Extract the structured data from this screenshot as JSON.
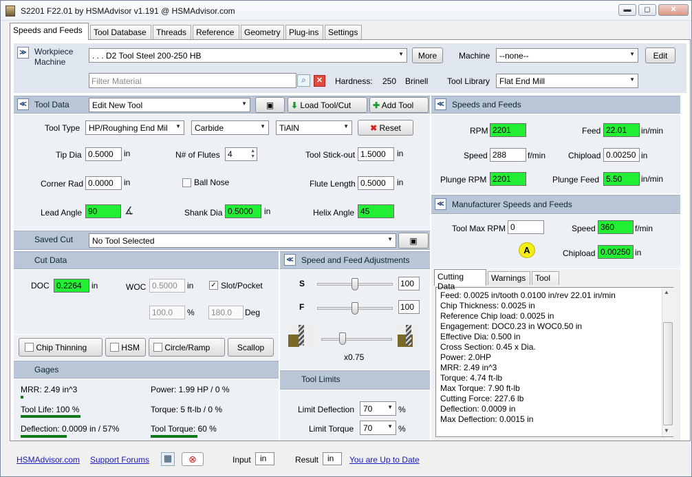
{
  "window": {
    "title": "S2201 F22.01 by HSMAdvisor v1.191 @ HSMAdvisor.com",
    "min": "▬",
    "max": "◻",
    "close": "✕"
  },
  "tabs": [
    "Speeds and Feeds",
    "Tool Database",
    "Threads",
    "Reference",
    "Geometry",
    "Plug-ins",
    "Settings"
  ],
  "workpiece": {
    "label_line1": "Workpiece",
    "label_line2": "Machine",
    "material": ". . . D2 Tool Steel 200-250 HB",
    "more": "More",
    "machine_label": "Machine",
    "machine": "--none--",
    "edit": "Edit",
    "filter_placeholder": "Filter Material",
    "hardness_label": "Hardness:",
    "hardness_value": "250",
    "hardness_unit": "Brinell",
    "library_label": "Tool Library",
    "library": "Flat End Mill"
  },
  "tool_data": {
    "header": "Tool Data",
    "tool_select": "Edit New Tool",
    "load": "Load Tool/Cut",
    "add": "Add Tool",
    "type_label": "Tool Type",
    "type": "HP/Roughing End Mil",
    "material": "Carbide",
    "coating": "TiAlN",
    "reset": "Reset",
    "tip_dia_label": "Tip Dia",
    "tip_dia": "0.5000",
    "tip_dia_unit": "in",
    "flutes_label": "N# of Flutes",
    "flutes": "4",
    "stickout_label": "Tool Stick-out",
    "stickout": "1.5000",
    "stickout_unit": "in",
    "corner_label": "Corner Rad",
    "corner": "0.0000",
    "corner_unit": "in",
    "ballnose_label": "Ball Nose",
    "flute_len_label": "Flute Length",
    "flute_len": "0.5000",
    "flute_len_unit": "in",
    "lead_label": "Lead Angle",
    "lead": "90",
    "shank_label": "Shank Dia",
    "shank": "0.5000",
    "shank_unit": "in",
    "helix_label": "Helix Angle",
    "helix": "45"
  },
  "saved_cut": {
    "label": "Saved Cut",
    "value": "No Tool Selected"
  },
  "cut_data": {
    "header": "Cut Data",
    "doc_label": "DOC",
    "doc": "0.2264",
    "doc_unit": "in",
    "woc_label": "WOC",
    "woc": "0.5000",
    "woc_unit": "in",
    "slot_label": "Slot/Pocket",
    "pct": "100.0",
    "pct_unit": "%",
    "deg": "180.0",
    "deg_unit": "Deg"
  },
  "options": {
    "chip_thinning": "Chip Thinning",
    "hsm": "HSM",
    "circle_ramp": "Circle/Ramp",
    "scallop": "Scallop"
  },
  "adjust": {
    "header": "Speed and Feed Adjustments",
    "s_label": "S",
    "s_value": "100",
    "f_label": "F",
    "f_value": "100",
    "factor": "x0.75",
    "s_level": 0.5,
    "f_level": 0.5,
    "engage_level": 0.3
  },
  "gages": {
    "header": "Gages",
    "mrr": "MRR: 2.49 in^3",
    "power": "Power: 1.99 HP / 0 %",
    "tool_life": "Tool Life: 100 %",
    "torque": "Torque: 5 ft-lb / 0 %",
    "deflection": "Deflection: 0.0009 in / 57%",
    "tool_torque": "Tool Torque: 60 %",
    "mrr_level": 0.0,
    "tool_life_level": 1.0,
    "deflection_level": 0.57,
    "tool_torque_level": 0.6
  },
  "limits": {
    "header": "Tool Limits",
    "deflection_label": "Limit Deflection",
    "deflection": "70",
    "torque_label": "Limit Torque",
    "torque": "70",
    "unit": "%"
  },
  "speeds": {
    "header": "Speeds and Feeds",
    "rpm_label": "RPM",
    "rpm": "2201",
    "feed_label": "Feed",
    "feed": "22.01",
    "feed_unit": "in/min",
    "speed_label": "Speed",
    "speed": "288",
    "speed_unit": "f/min",
    "chipload_label": "Chipload",
    "chipload": "0.00250",
    "chipload_unit": "in",
    "plunge_rpm_label": "Plunge RPM",
    "plunge_rpm": "2201",
    "plunge_feed_label": "Plunge Feed",
    "plunge_feed": "5.50",
    "plunge_feed_unit": "in/min"
  },
  "manufacturer": {
    "header": "Manufacturer Speeds and Feeds",
    "max_rpm_label": "Tool Max RPM",
    "max_rpm": "0",
    "speed_label": "Speed",
    "speed": "360",
    "speed_unit": "f/min",
    "chipload_label": "Chipload",
    "chipload": "0.00250",
    "chipload_unit": "in",
    "badge": "A"
  },
  "output_tabs": [
    "Cutting Data",
    "Warnings",
    "Tool"
  ],
  "cutting_data": [
    "Feed: 0.0025 in/tooth 0.0100 in/rev 22.01 in/min",
    "Chip Thickness: 0.0025 in",
    "Reference Chip load: 0.0025 in",
    "Engagement: DOC0.23 in  WOC0.50 in",
    "Effective Dia: 0.500 in",
    "Cross Section: 0.45 x Dia.",
    "Power: 2.0HP",
    "MRR: 2.49 in^3",
    "Torque: 4.74 ft-lb",
    "Max Torque: 7.90 ft-lb",
    "Cutting Force: 227.6 lb",
    "Deflection: 0.0009 in",
    "Max Deflection: 0.0015 in"
  ],
  "footer": {
    "site": "HSMAdvisor.com",
    "forums": "Support Forums",
    "input_label": "Input",
    "input": "in",
    "result_label": "Result",
    "result": "in",
    "update": "You are Up to Date"
  }
}
